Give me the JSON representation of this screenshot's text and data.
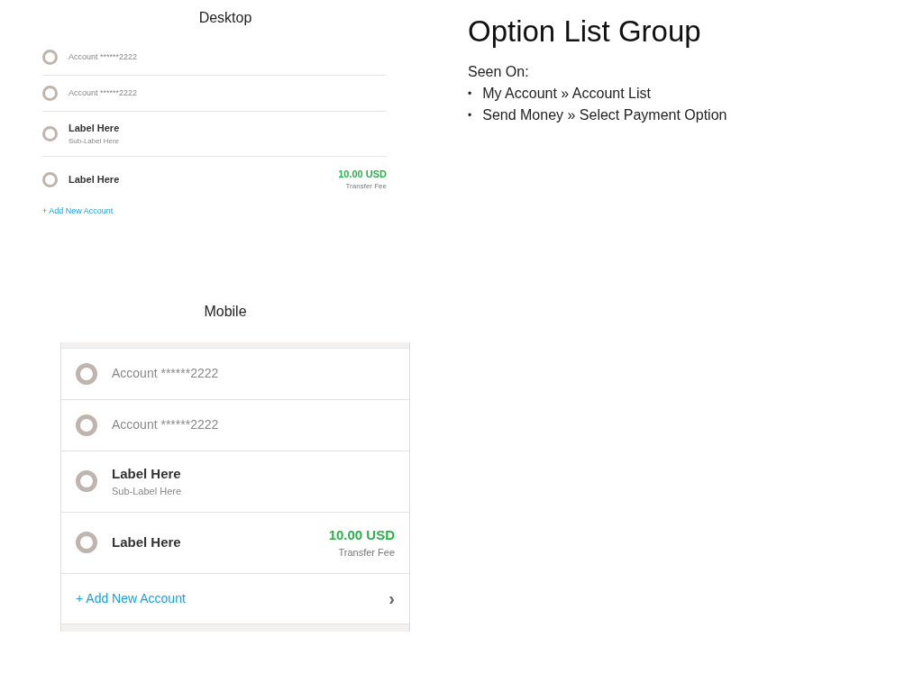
{
  "desktop": {
    "caption": "Desktop",
    "options": [
      {
        "label": "Account ******2222",
        "emphasis": false,
        "selected": false
      },
      {
        "label": "Account ******2222",
        "emphasis": false,
        "selected": false
      },
      {
        "label": "Label Here",
        "sublabel": "Sub-Label Here",
        "emphasis": true,
        "selected": false
      },
      {
        "label": "Label Here",
        "amount": "10.00 USD",
        "amount_note": "Transfer Fee",
        "emphasis": true,
        "selected": false
      }
    ],
    "add_link": "+ Add New Account"
  },
  "mobile": {
    "caption": "Mobile",
    "options": [
      {
        "label": "Account ******2222",
        "emphasis": false,
        "selected": false
      },
      {
        "label": "Account ******2222",
        "emphasis": false,
        "selected": false
      },
      {
        "label": "Label Here",
        "sublabel": "Sub-Label Here",
        "emphasis": true,
        "selected": false
      },
      {
        "label": "Label Here",
        "amount": "10.00 USD",
        "amount_note": "Transfer Fee",
        "emphasis": true,
        "selected": false
      }
    ],
    "add_link": "+ Add New Account",
    "add_chevron": "›"
  },
  "notes": {
    "title": "Option List Group",
    "seen_on": "Seen On:",
    "items": [
      {
        "bullet": "•",
        "text": "My Account » Account List"
      },
      {
        "bullet": "•",
        "text": "Send Money » Select Payment Option"
      }
    ]
  }
}
